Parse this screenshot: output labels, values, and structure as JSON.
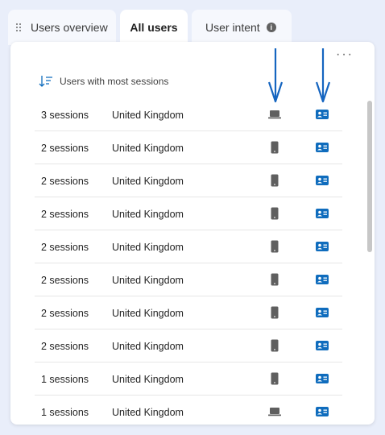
{
  "tabs": [
    {
      "label": "Users overview",
      "active": false
    },
    {
      "label": "All users",
      "active": true
    },
    {
      "label": "User intent",
      "active": false
    }
  ],
  "card": {
    "more_label": "···",
    "sort_label": "Users with most sessions"
  },
  "rows": [
    {
      "sessions": "3 sessions",
      "country": "United Kingdom",
      "device": "laptop"
    },
    {
      "sessions": "2 sessions",
      "country": "United Kingdom",
      "device": "phone"
    },
    {
      "sessions": "2 sessions",
      "country": "United Kingdom",
      "device": "phone"
    },
    {
      "sessions": "2 sessions",
      "country": "United Kingdom",
      "device": "phone"
    },
    {
      "sessions": "2 sessions",
      "country": "United Kingdom",
      "device": "phone"
    },
    {
      "sessions": "2 sessions",
      "country": "United Kingdom",
      "device": "phone"
    },
    {
      "sessions": "2 sessions",
      "country": "United Kingdom",
      "device": "phone"
    },
    {
      "sessions": "2 sessions",
      "country": "United Kingdom",
      "device": "phone"
    },
    {
      "sessions": "1 sessions",
      "country": "United Kingdom",
      "device": "phone"
    },
    {
      "sessions": "1 sessions",
      "country": "United Kingdom",
      "device": "laptop"
    }
  ],
  "colors": {
    "accent": "#0f6cbd",
    "annotation_arrow": "#1565c0",
    "device_icon": "#616161"
  },
  "icons": [
    "drag-grip-icon",
    "info-icon",
    "sort-descending-icon",
    "laptop-icon",
    "phone-icon",
    "contact-card-icon",
    "down-arrow-annotation"
  ]
}
